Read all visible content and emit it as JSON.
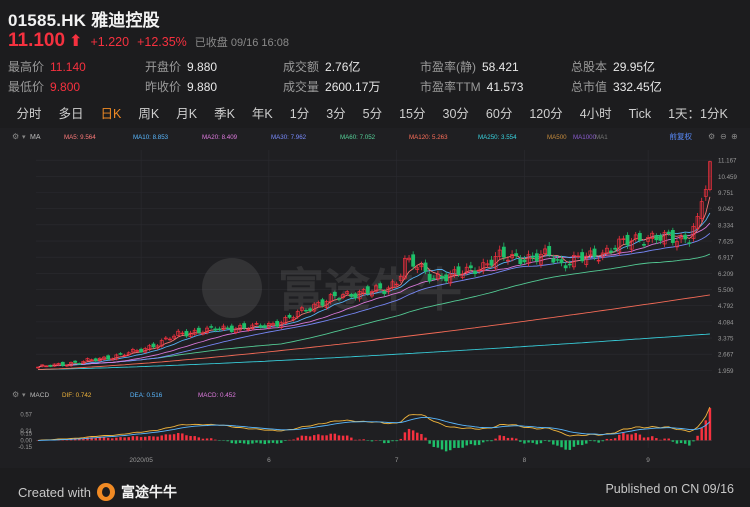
{
  "header": {
    "title": "01585.HK 雅迪控股",
    "price": "11.100",
    "arrow": "⬆",
    "change": "+1.220",
    "change_pct": "+12.35%",
    "status": "已收盘",
    "timestamp": "09/16 16:08"
  },
  "stats": [
    {
      "key": "最高价",
      "value": "11.140",
      "tone": "up"
    },
    {
      "key": "开盘价",
      "value": "9.880",
      "tone": ""
    },
    {
      "key": "成交额",
      "value": "2.76亿",
      "tone": ""
    },
    {
      "key": "市盈率(静)",
      "value": "58.421",
      "tone": ""
    },
    {
      "key": "总股本",
      "value": "29.95亿",
      "tone": ""
    },
    {
      "key": "最低价",
      "value": "9.800",
      "tone": "up"
    },
    {
      "key": "昨收价",
      "value": "9.880",
      "tone": ""
    },
    {
      "key": "成交量",
      "value": "2600.17万",
      "tone": ""
    },
    {
      "key": "市盈率TTM",
      "value": "41.573",
      "tone": ""
    },
    {
      "key": "总市值",
      "value": "332.45亿",
      "tone": ""
    }
  ],
  "tabs": [
    "分时",
    "多日",
    "日K",
    "周K",
    "月K",
    "季K",
    "年K",
    "1分",
    "3分",
    "5分",
    "15分",
    "30分",
    "60分",
    "120分",
    "4小时",
    "Tick",
    "1天：1分K"
  ],
  "active_tab": 2,
  "legend": {
    "label": "MA",
    "items": [
      {
        "text": "MA5: 9.564",
        "color": "#ff7b7b"
      },
      {
        "text": "MA10: 8.853",
        "color": "#5ab8ff"
      },
      {
        "text": "MA20: 8.409",
        "color": "#e07be0"
      },
      {
        "text": "MA30: 7.962",
        "color": "#7a8cff"
      },
      {
        "text": "MA60: 7.052",
        "color": "#56d39a"
      },
      {
        "text": "MA120: 5.263",
        "color": "#ff6f5a"
      },
      {
        "text": "MA250: 3.554",
        "color": "#39d4e0"
      },
      {
        "text": "MA500",
        "color": "#c48a3c"
      },
      {
        "text": "MA1000",
        "color": "#8a5ccf"
      },
      {
        "text": "MA1",
        "color": "#777777"
      }
    ],
    "adjust": "前复权"
  },
  "macd_legend": {
    "label": "MACD",
    "items": [
      {
        "text": "DIF: 0.742",
        "color": "#f0b43c"
      },
      {
        "text": "DEA: 0.516",
        "color": "#5ab8ff"
      },
      {
        "text": "MACD: 0.452",
        "color": "#e07be0"
      }
    ]
  },
  "watermark": "富途牛牛",
  "footer": {
    "created": "Created with",
    "brand": "富途牛牛",
    "published": "Published on CN 09/16"
  },
  "chart_data": {
    "type": "candlestick",
    "price_axis_ticks": [
      "11.167",
      "10.459",
      "9.751",
      "9.042",
      "8.334",
      "7.625",
      "6.917",
      "6.209",
      "5.500",
      "4.792",
      "4.084",
      "3.375",
      "2.667",
      "1.959"
    ],
    "ylim": [
      1.959,
      11.167
    ],
    "macd_axis_ticks": [
      "0.57",
      "0.21",
      "0.15",
      "0.00",
      "-0.15"
    ],
    "macd_ylim": [
      -0.15,
      0.75
    ],
    "x_ticks": [
      "2020/05",
      "6",
      "7",
      "8",
      "9"
    ],
    "x_tick_index": [
      25,
      56,
      87,
      118,
      148
    ],
    "last_close": 11.1,
    "last_high": 11.14,
    "last_low": 9.8,
    "last_open": 9.88,
    "ma_final": {
      "MA5": 9.564,
      "MA10": 8.853,
      "MA20": 8.409,
      "MA30": 7.962,
      "MA60": 7.052,
      "MA120": 5.263,
      "MA250": 3.554
    },
    "close_anchors": [
      [
        0,
        2.1
      ],
      [
        10,
        2.32
      ],
      [
        18,
        2.55
      ],
      [
        25,
        2.85
      ],
      [
        30,
        3.2
      ],
      [
        34,
        3.55
      ],
      [
        40,
        3.7
      ],
      [
        45,
        3.8
      ],
      [
        52,
        3.85
      ],
      [
        56,
        3.95
      ],
      [
        60,
        4.15
      ],
      [
        64,
        4.55
      ],
      [
        68,
        4.9
      ],
      [
        72,
        5.15
      ],
      [
        76,
        5.3
      ],
      [
        80,
        5.45
      ],
      [
        84,
        5.45
      ],
      [
        87,
        5.85
      ],
      [
        89,
        6.8
      ],
      [
        92,
        6.5
      ],
      [
        95,
        6.05
      ],
      [
        100,
        6.1
      ],
      [
        104,
        6.3
      ],
      [
        108,
        6.55
      ],
      [
        112,
        6.95
      ],
      [
        116,
        6.9
      ],
      [
        120,
        6.85
      ],
      [
        124,
        7.05
      ],
      [
        127,
        6.6
      ],
      [
        130,
        6.8
      ],
      [
        134,
        6.95
      ],
      [
        137,
        7.1
      ],
      [
        140,
        7.4
      ],
      [
        144,
        7.65
      ],
      [
        148,
        7.8
      ],
      [
        152,
        7.75
      ],
      [
        156,
        7.7
      ],
      [
        158,
        7.85
      ],
      [
        160,
        8.7
      ],
      [
        161,
        9.35
      ],
      [
        162,
        9.88
      ],
      [
        163,
        11.1
      ]
    ],
    "macd_hist_pattern": "positive rising in May, small in June, mixed July–Aug, strongly positive mid-September"
  }
}
